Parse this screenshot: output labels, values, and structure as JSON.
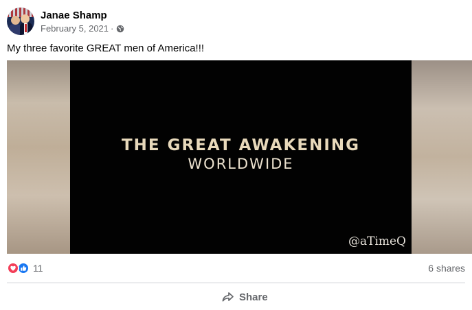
{
  "post": {
    "author": "Janae Shamp",
    "date": "February 5, 2021",
    "date_separator": "·",
    "privacy_icon": "globe-icon",
    "caption": "My three favorite GREAT men of America!!!"
  },
  "video": {
    "title_line1": "THE GREAT AWAKENING",
    "title_line2": "WORLDWIDE",
    "watermark": "@aTimeQ"
  },
  "engagement": {
    "reaction_icons": [
      "love-icon",
      "like-icon"
    ],
    "reaction_count": "11",
    "shares": "6 shares"
  },
  "actions": {
    "share_label": "Share",
    "share_icon": "share-arrow-icon"
  },
  "colors": {
    "love": "#f33e58",
    "like": "#1877f2",
    "secondary_text": "#65676b"
  }
}
